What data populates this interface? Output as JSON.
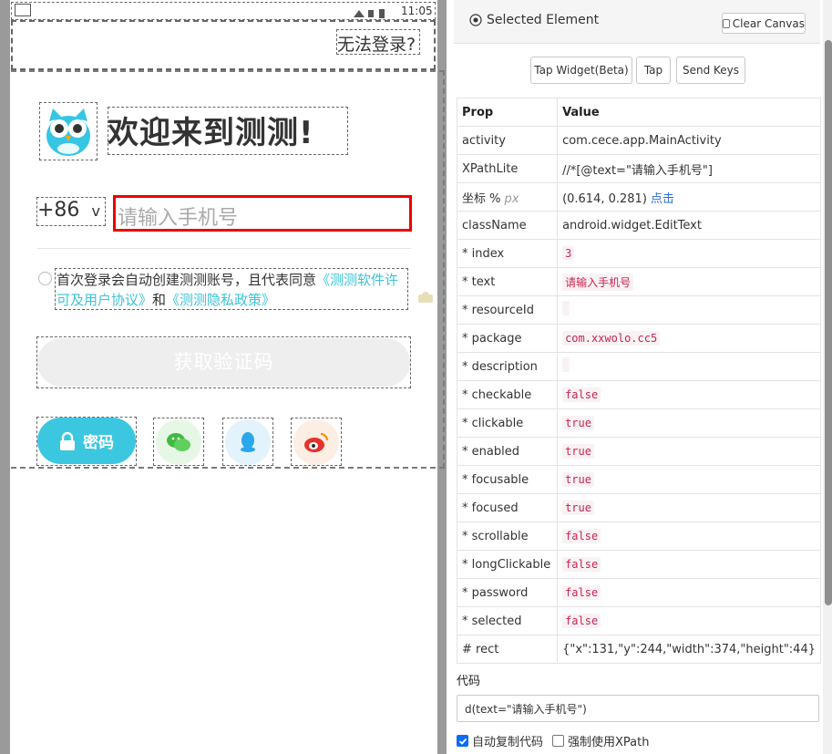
{
  "phone": {
    "status_time": "11:05",
    "cannot_login": "无法登录?",
    "welcome_title": "欢迎来到测测!",
    "country_code": "+86",
    "country_chevron": "v",
    "phone_placeholder": "请输入手机号",
    "terms_prefix": "首次登录会自动创建测测账号，且代表同意",
    "terms_link1": "《测测软件许可及用户协议》",
    "terms_and": "和",
    "terms_link2": "《测测隐私政策》",
    "get_code_button": "获取验证码",
    "password_button": "密码",
    "social_icons": [
      "wechat-icon",
      "qq-icon",
      "weibo-icon"
    ]
  },
  "inspector": {
    "title": "Selected Element",
    "clear_canvas": "Clear Canvas",
    "actions": [
      "Tap Widget(Beta)",
      "Tap",
      "Send Keys"
    ],
    "table_headers": {
      "prop": "Prop",
      "value": "Value"
    },
    "rows": [
      {
        "prop": "activity",
        "value": "com.cece.app.MainActivity",
        "style": "plain"
      },
      {
        "prop": "XPathLite",
        "value": "//*[@text=\"请输入手机号\"]",
        "style": "plain"
      },
      {
        "prop": "坐标 %",
        "prop_suffix": "px",
        "value": "(0.614, 0.281)",
        "value_link": "点击",
        "style": "coord"
      },
      {
        "prop": "className",
        "value": "android.widget.EditText",
        "style": "plain"
      },
      {
        "prop": "* index",
        "value": "3",
        "style": "code"
      },
      {
        "prop": "* text",
        "value": "请输入手机号",
        "style": "code"
      },
      {
        "prop": "* resourceId",
        "value": "",
        "style": "code"
      },
      {
        "prop": "* package",
        "value": "com.xxwolo.cc5",
        "style": "code"
      },
      {
        "prop": "* description",
        "value": "",
        "style": "code"
      },
      {
        "prop": "* checkable",
        "value": "false",
        "style": "code"
      },
      {
        "prop": "* clickable",
        "value": "true",
        "style": "code"
      },
      {
        "prop": "* enabled",
        "value": "true",
        "style": "code"
      },
      {
        "prop": "* focusable",
        "value": "true",
        "style": "code"
      },
      {
        "prop": "* focused",
        "value": "true",
        "style": "code"
      },
      {
        "prop": "* scrollable",
        "value": "false",
        "style": "code"
      },
      {
        "prop": "* longClickable",
        "value": "false",
        "style": "code"
      },
      {
        "prop": "* password",
        "value": "false",
        "style": "code"
      },
      {
        "prop": "* selected",
        "value": "false",
        "style": "code"
      },
      {
        "prop": "# rect",
        "value": "{\"x\":131,\"y\":244,\"width\":374,\"height\":44}",
        "style": "plain"
      }
    ],
    "code_label": "代码",
    "code_value": "d(text=\"请输入手机号\")",
    "auto_copy_label": "自动复制代码",
    "auto_copy_checked": true,
    "force_xpath_label": "强制使用XPath",
    "force_xpath_checked": false
  },
  "colors": {
    "accent": "#3cc7e0",
    "link": "#3cc3d7",
    "highlight": "#ee0000",
    "code_text": "#c7254e"
  }
}
